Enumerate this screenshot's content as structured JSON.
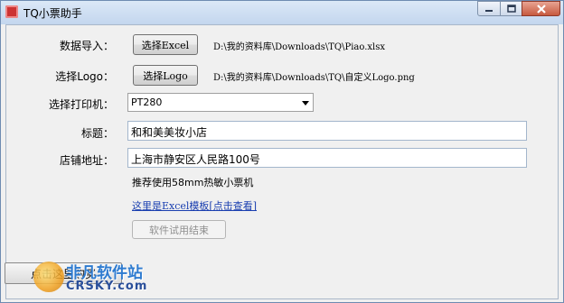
{
  "window": {
    "title": "TQ小票助手",
    "controls": {
      "minimize": "minimize-icon",
      "maximize": "maximize-icon",
      "close": "close-icon"
    }
  },
  "form": {
    "data_import": {
      "label": "数据导入：",
      "button": "选择Excel",
      "path": "D:\\我的资料库\\Downloads\\TQ\\Piao.xlsx"
    },
    "logo": {
      "label": "选择Logo：",
      "button": "选择Logo",
      "path": "D:\\我的资料库\\Downloads\\TQ\\自定义Logo.png"
    },
    "printer": {
      "label": "选择打印机：",
      "value": "PT280"
    },
    "title": {
      "label": "标题：",
      "value": "和和美美妆小店"
    },
    "address": {
      "label": "店铺地址：",
      "value": "上海市静安区人民路100号"
    },
    "recommend_note": "推荐使用58mm热敏小票机",
    "template_link": "这里是Excel模板[点击查看]",
    "trial_button": "软件试用结束",
    "buy_button": "点击这里购买"
  },
  "watermark": {
    "title": "非凡软件站",
    "subtitle": "CRSKY.com"
  }
}
